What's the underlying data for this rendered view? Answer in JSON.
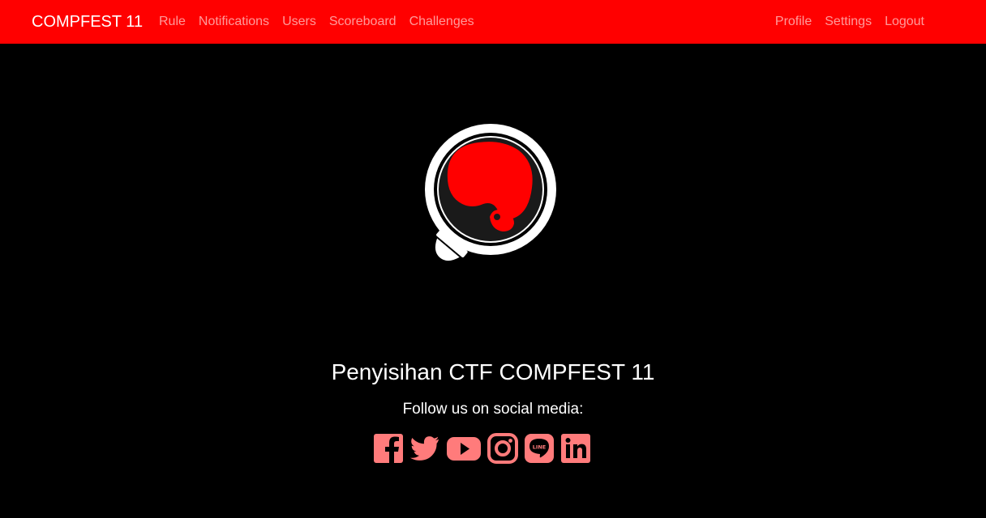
{
  "navbar": {
    "brand": "COMPFEST 11",
    "left_links": [
      "Rule",
      "Notifications",
      "Users",
      "Scoreboard",
      "Challenges"
    ],
    "right_links": [
      "Profile",
      "Settings",
      "Logout"
    ]
  },
  "main": {
    "title": "Penyisihan CTF COMPFEST 11",
    "subtitle": "Follow us on social media:",
    "socials": [
      "facebook-icon",
      "twitter-icon",
      "youtube-icon",
      "instagram-icon",
      "line-icon",
      "linkedin-icon"
    ],
    "line_label": "LINE"
  },
  "colors": {
    "navbar_bg": "#ff0000",
    "page_bg": "#000000",
    "social_icon": "#ff7b7b",
    "logo_red": "#ff0000"
  }
}
